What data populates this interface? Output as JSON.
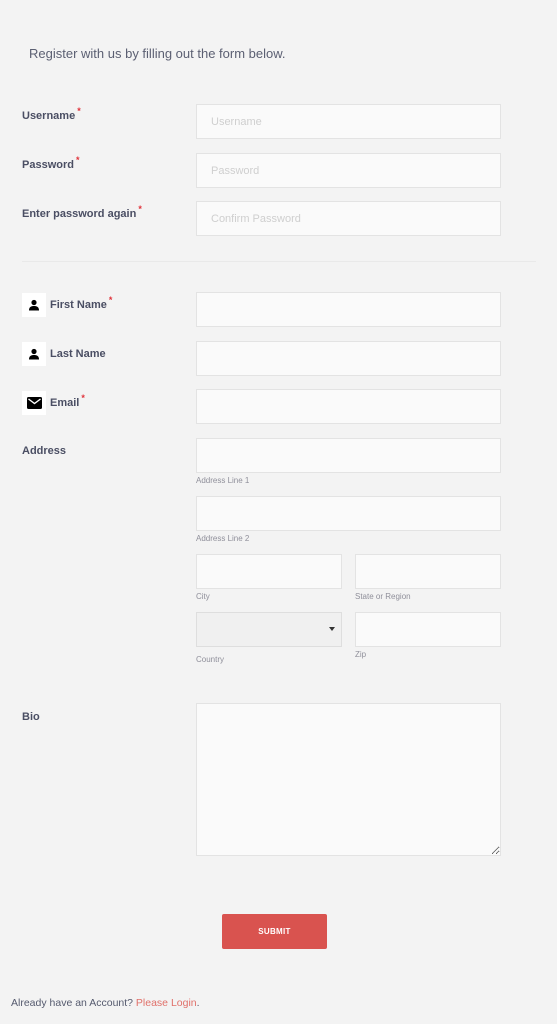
{
  "intro": "Register with us by filling out the form below.",
  "account": {
    "username": {
      "label": "Username",
      "required": "*",
      "placeholder": "Username",
      "value": ""
    },
    "password": {
      "label": "Password",
      "required": "*",
      "placeholder": "Password",
      "value": ""
    },
    "confirm": {
      "label": "Enter password again",
      "required": "*",
      "placeholder": "Confirm Password",
      "value": ""
    }
  },
  "profile": {
    "first_name": {
      "label": "First Name",
      "required": "*",
      "icon": "person-icon",
      "value": ""
    },
    "last_name": {
      "label": "Last Name",
      "icon": "person-icon",
      "value": ""
    },
    "email": {
      "label": "Email",
      "required": "*",
      "icon": "envelope-icon",
      "value": ""
    }
  },
  "address": {
    "label": "Address",
    "line1": {
      "sublabel": "Address Line 1",
      "value": ""
    },
    "line2": {
      "sublabel": "Address Line 2",
      "value": ""
    },
    "city": {
      "sublabel": "City",
      "value": ""
    },
    "state": {
      "sublabel": "State or Region",
      "value": ""
    },
    "country": {
      "sublabel": "Country",
      "selected": ""
    },
    "zip": {
      "sublabel": "Zip",
      "value": ""
    }
  },
  "bio": {
    "label": "Bio",
    "value": ""
  },
  "submit_label": "SUBMIT",
  "footer": {
    "text": "Already have an Account? ",
    "link": "Please Login",
    "suffix": "."
  },
  "colors": {
    "accent": "#d9534f",
    "required": "#e0323a",
    "link": "#e0706a",
    "background": "#f3f3f3"
  }
}
